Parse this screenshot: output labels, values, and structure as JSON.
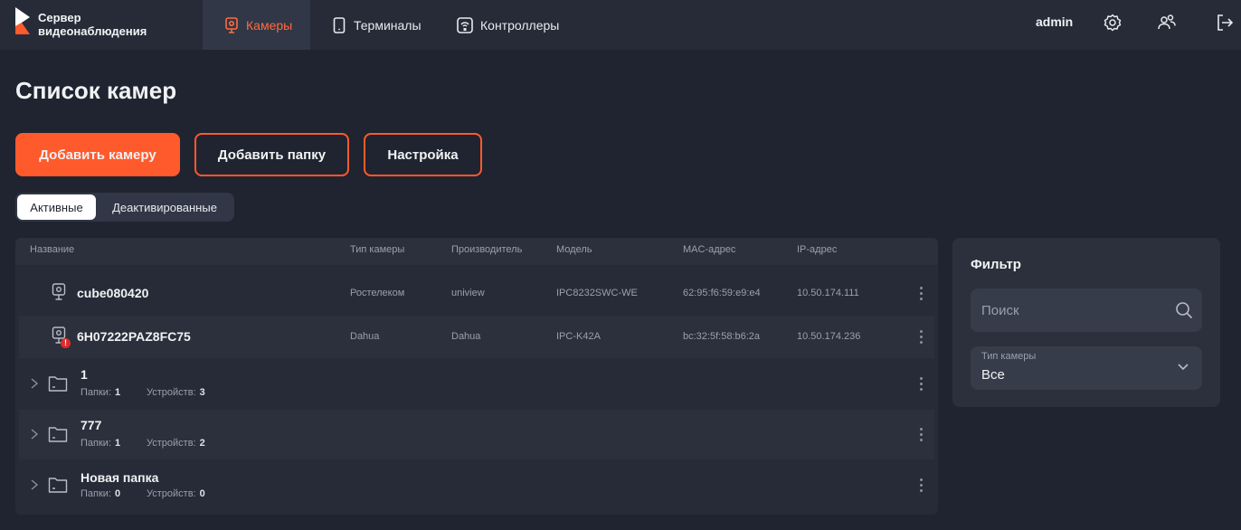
{
  "app": {
    "logo_line1": "Сервер",
    "logo_line2": "видеонаблюдения"
  },
  "nav": {
    "cameras": "Камеры",
    "terminals": "Терминалы",
    "controllers": "Контроллеры"
  },
  "user": {
    "name": "admin"
  },
  "page": {
    "title": "Список камер"
  },
  "buttons": {
    "add_camera": "Добавить камеру",
    "add_folder": "Добавить папку",
    "settings": "Настройка"
  },
  "tabs": {
    "active": "Активные",
    "deactivated": "Деактивированные"
  },
  "table": {
    "headers": {
      "name": "Название",
      "type": "Тип камеры",
      "vendor": "Производитель",
      "model": "Модель",
      "mac": "MAC-адрес",
      "ip": "IP-адрес"
    },
    "cameras": [
      {
        "name": "cube080420",
        "type": "Ростелеком",
        "vendor": "uniview",
        "model": "IPC8232SWC-WE",
        "mac": "62:95:f6:59:e9:e4",
        "ip": "10.50.174.111",
        "warning": false
      },
      {
        "name": "6H07222PAZ8FC75",
        "type": "Dahua",
        "vendor": "Dahua",
        "model": "IPC-K42A",
        "mac": "bc:32:5f:58:b6:2a",
        "ip": "10.50.174.236",
        "warning": true,
        "warning_badge": "!"
      }
    ],
    "folders_label": "Папки:",
    "devices_label": "Устройств:",
    "folders": [
      {
        "name": "1",
        "folders": "1",
        "devices": "3"
      },
      {
        "name": "777",
        "folders": "1",
        "devices": "2"
      },
      {
        "name": "Новая папка",
        "folders": "0",
        "devices": "0"
      }
    ]
  },
  "filter": {
    "title": "Фильтр",
    "search_placeholder": "Поиск",
    "camera_type_label": "Тип камеры",
    "camera_type_value": "Все"
  },
  "colors": {
    "accent": "#ff5a2c",
    "background": "#1f2430",
    "panel": "#262b37"
  }
}
